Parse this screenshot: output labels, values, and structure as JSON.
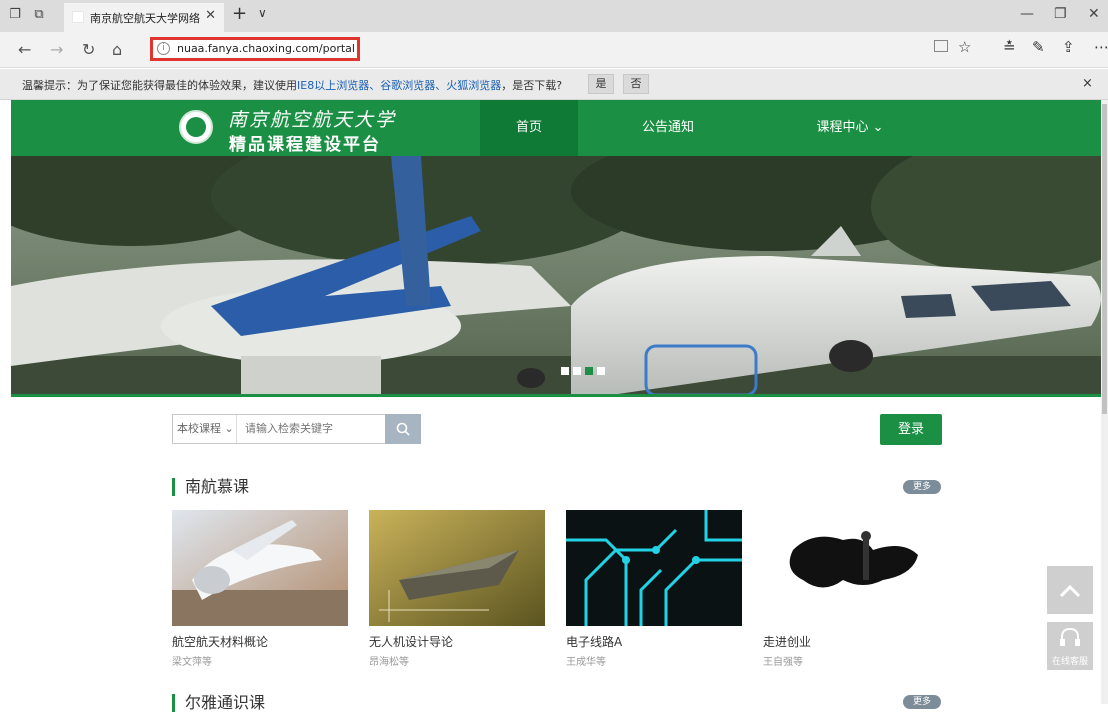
{
  "browser": {
    "tab_title": "南京航空航天大学网络教",
    "new_tab": "+",
    "tab_menu": "∨",
    "address": "nuaa.fanya.chaoxing.com/portal"
  },
  "infobar": {
    "text_prefix": "温馨提示：为了保证您能获得最佳的体验效果，建议使用",
    "links": "IE8以上浏览器、谷歌浏览器、火狐浏览器",
    "text_suffix": "，是否下载?",
    "yes": "是",
    "no": "否",
    "close": "×"
  },
  "site": {
    "logo_line1": "南京航空航天大学",
    "logo_line2": "精品课程建设平台",
    "nav": [
      {
        "label": "首页",
        "active": true
      },
      {
        "label": "公告通知",
        "active": false
      },
      {
        "label": "课程中心 ⌄",
        "active": false
      }
    ]
  },
  "banner": {
    "slide_count": 4,
    "active_slide": 3,
    "accent": "#1b9045"
  },
  "search": {
    "scope": "本校课程 ⌄",
    "placeholder": "请输入检索关键字",
    "button_icon": "search-icon"
  },
  "login_label": "登录",
  "sections": [
    {
      "title": "南航慕课",
      "more": "更多",
      "courses": [
        {
          "name": "航空航天材料概论",
          "author": "梁文萍等"
        },
        {
          "name": "无人机设计导论",
          "author": "昂海松等"
        },
        {
          "name": "电子线路A",
          "author": "王成华等"
        },
        {
          "name": "走进创业",
          "author": "王自强等"
        }
      ]
    },
    {
      "title": "尔雅通识课",
      "more": "更多"
    }
  ],
  "float": {
    "service_label": "在线客服"
  },
  "colors": {
    "brand_green": "#1b9045",
    "highlight_red": "#e0352e"
  }
}
